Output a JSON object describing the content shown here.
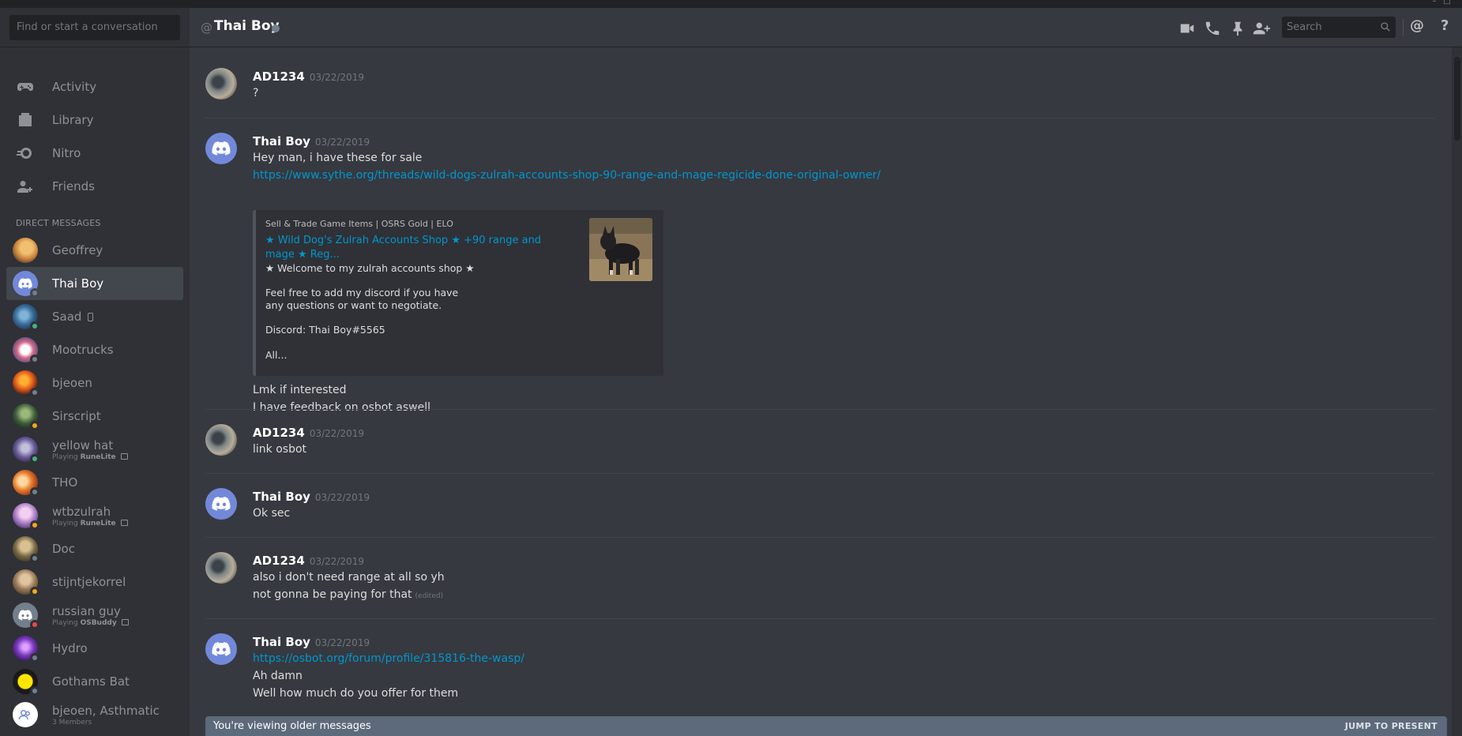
{
  "sidebar": {
    "search_placeholder": "Find or start a conversation",
    "nav": [
      {
        "label": "Activity",
        "icon": "controller-icon"
      },
      {
        "label": "Library",
        "icon": "library-icon"
      },
      {
        "label": "Nitro",
        "icon": "nitro-icon"
      },
      {
        "label": "Friends",
        "icon": "friends-icon"
      }
    ],
    "dm_header": "DIRECT MESSAGES",
    "dms": [
      {
        "name": "Geoffrey",
        "status": "",
        "selected": false
      },
      {
        "name": "Thai Boy",
        "status": "offline",
        "selected": true
      },
      {
        "name": "Saad",
        "status": "online",
        "mobile": true
      },
      {
        "name": "Mootrucks",
        "status": "offline"
      },
      {
        "name": "bjeoen",
        "status": "offline"
      },
      {
        "name": "Sirscript",
        "status": "idle"
      },
      {
        "name": "yellow hat",
        "status": "online",
        "sub_prefix": "Playing ",
        "sub_game": "RuneLite"
      },
      {
        "name": "THO",
        "status": "offline"
      },
      {
        "name": "wtbzulrah",
        "status": "idle",
        "sub_prefix": "Playing ",
        "sub_game": "RuneLite"
      },
      {
        "name": "Doc",
        "status": "offline"
      },
      {
        "name": "stijntjekorrel",
        "status": "idle"
      },
      {
        "name": "russian guy",
        "status": "dnd",
        "sub_prefix": "Playing ",
        "sub_game": "OSBuddy"
      },
      {
        "name": "Hydro",
        "status": "offline"
      },
      {
        "name": "Gothams Bat",
        "status": "offline"
      },
      {
        "name": "bjeoen, Asthmatic",
        "status": "",
        "sub_prefix": "3 Members",
        "sub_game": ""
      }
    ]
  },
  "header": {
    "at_symbol": "@",
    "title": "Thai Boy",
    "search_placeholder": "Search",
    "mention_icon": "@",
    "help_icon": "?"
  },
  "messages": [
    {
      "author": "AD1234",
      "timestamp": "03/22/2019",
      "lines": [
        "?"
      ]
    },
    {
      "author": "Thai Boy",
      "timestamp": "03/22/2019",
      "lines": [
        "Hey man, i have these for sale",
        "https://www.sythe.org/threads/wild-dogs-zulrah-accounts-shop-90-range-and-mage-regicide-done-original-owner/"
      ],
      "embed": {
        "provider": "Sell & Trade Game Items | OSRS Gold | ELO",
        "title": "★ Wild Dog's Zulrah Accounts Shop ★ +90 range and mage ★ Reg...",
        "desc": [
          "★ Welcome to my zulrah accounts shop ★",
          "Feel free to add my discord if you have",
          "any questions or want to negotiate.",
          "Discord: Thai Boy#5565",
          "All..."
        ]
      },
      "after": [
        "Lmk if interested",
        "I have feedback on osbot aswell"
      ]
    },
    {
      "author": "AD1234",
      "timestamp": "03/22/2019",
      "lines": [
        "link osbot"
      ]
    },
    {
      "author": "Thai Boy",
      "timestamp": "03/22/2019",
      "lines": [
        "Ok sec"
      ]
    },
    {
      "author": "AD1234",
      "timestamp": "03/22/2019",
      "lines": [
        "also i don't need range at all so yh",
        "not gonna be paying for that"
      ],
      "edited": "(edited)"
    },
    {
      "author": "Thai Boy",
      "timestamp": "03/22/2019",
      "lines": [
        "https://osbot.org/forum/profile/315816-the-wasp/",
        "Ah damn",
        "Well how much do you offer for them"
      ]
    }
  ],
  "older_bar": {
    "label": "You're viewing older messages",
    "jump": "JUMP TO PRESENT"
  },
  "colors": {
    "bg": "#36393f",
    "sidebar": "#2f3136",
    "blurple": "#7289da",
    "link": "#0096cf",
    "online": "#43b581",
    "idle": "#faa61a",
    "dnd": "#f04747",
    "offline": "#747f8d"
  }
}
